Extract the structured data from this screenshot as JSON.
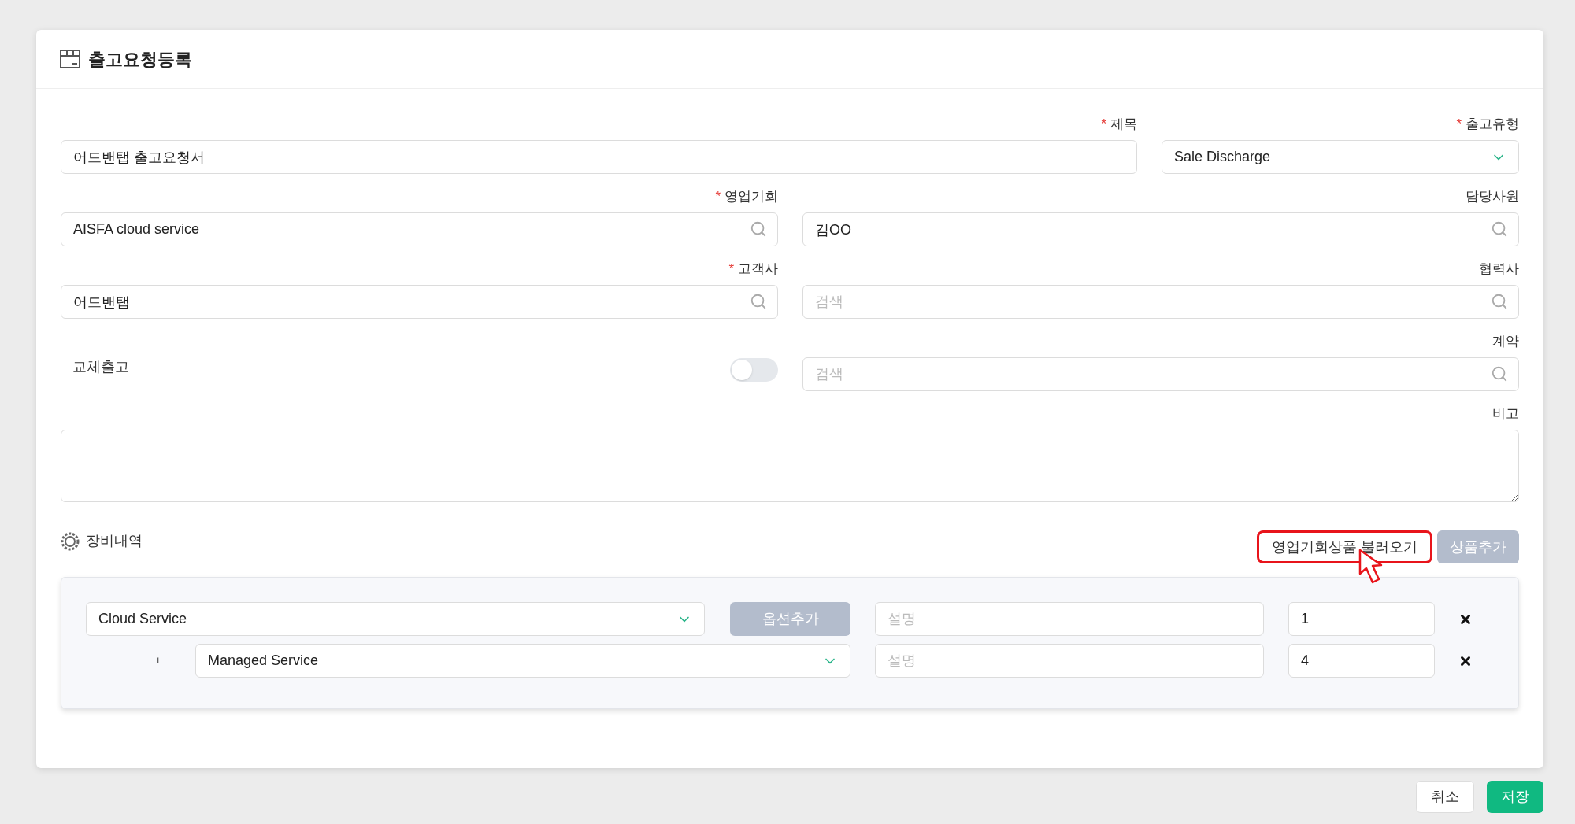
{
  "page": {
    "title": "출고요청등록"
  },
  "required_mark": "*",
  "form": {
    "rows": [
      {
        "fields": [
          {
            "kind": "text",
            "label": "제목",
            "required": true,
            "value": "어드밴탭 출고요청서"
          },
          {
            "kind": "select",
            "label": "출고유형",
            "required": true,
            "value": "Sale Discharge"
          }
        ]
      },
      {
        "fields": [
          {
            "kind": "search",
            "label": "영업기회",
            "required": true,
            "value": "AISFA cloud service"
          },
          {
            "kind": "search",
            "label": "담당사원",
            "required": false,
            "value": "김OO"
          }
        ]
      },
      {
        "fields": [
          {
            "kind": "search",
            "label": "고객사",
            "required": true,
            "value": "어드밴탭"
          },
          {
            "kind": "search",
            "label": "협력사",
            "required": false,
            "placeholder": "검색"
          }
        ]
      },
      {
        "fields": [
          {
            "kind": "toggle",
            "label": "교체출고",
            "on": false
          },
          {
            "kind": "search",
            "label": "계약",
            "required": false,
            "placeholder": "검색"
          }
        ]
      },
      {
        "fields": [
          {
            "kind": "textarea",
            "label": "비고",
            "required": false
          }
        ]
      }
    ]
  },
  "equipment": {
    "title": "장비내역",
    "buttons": [
      {
        "label": "영업기회상품 불러오기",
        "disabled": false,
        "highlighted": true
      },
      {
        "label": "상품추가",
        "disabled": true,
        "highlighted": false
      }
    ],
    "items": [
      {
        "product": "Cloud Service",
        "option_button": "옵션추가",
        "description_placeholder": "설명",
        "quantity": "1",
        "children": [
          {
            "prefix": "ㄴ",
            "product": "Managed Service",
            "description_placeholder": "설명",
            "quantity": "4"
          }
        ]
      }
    ]
  },
  "footer": {
    "buttons": [
      {
        "label": "취소",
        "kind": "secondary"
      },
      {
        "label": "저장",
        "kind": "primary"
      }
    ]
  }
}
